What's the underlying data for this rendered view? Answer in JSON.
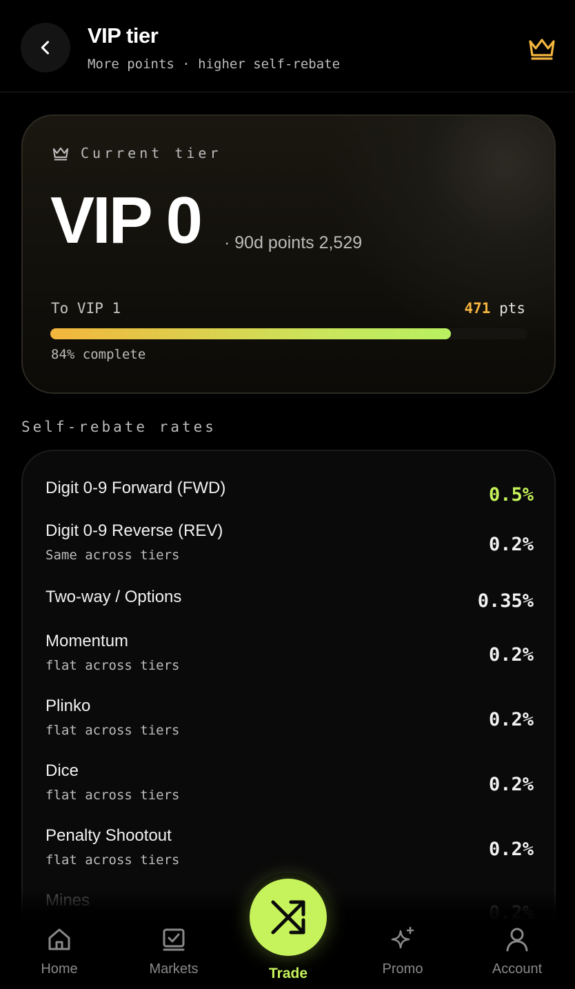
{
  "header": {
    "title": "VIP tier",
    "subtitle": "More points · higher self-rebate"
  },
  "tier_card": {
    "label": "Current tier",
    "tier_name": "VIP 0",
    "points_text": "· 90d points 2,529",
    "next_label": "To VIP 1",
    "points_needed": "471",
    "points_unit": "pts",
    "progress_percent": 84,
    "complete_text": "84% complete"
  },
  "rates": {
    "section_title": "Self-rebate rates",
    "items": [
      {
        "name": "Digit 0-9 Forward (FWD)",
        "note": "",
        "value": "0.5%",
        "accent": true
      },
      {
        "name": "Digit 0-9 Reverse (REV)",
        "note": "Same across tiers",
        "value": "0.2%"
      },
      {
        "name": "Two-way / Options",
        "note": "",
        "value": "0.35%"
      },
      {
        "name": "Momentum",
        "note": "flat across tiers",
        "value": "0.2%"
      },
      {
        "name": "Plinko",
        "note": "flat across tiers",
        "value": "0.2%"
      },
      {
        "name": "Dice",
        "note": "flat across tiers",
        "value": "0.2%"
      },
      {
        "name": "Penalty Shootout",
        "note": "flat across tiers",
        "value": "0.2%"
      },
      {
        "name": "Mines",
        "note": "",
        "value": "0.2%"
      }
    ]
  },
  "nav": {
    "home": "Home",
    "markets": "Markets",
    "trade": "Trade",
    "promo": "Promo",
    "account": "Account"
  },
  "colors": {
    "accent": "#c6f35b",
    "gold": "#f5b53f",
    "background": "#000000"
  }
}
